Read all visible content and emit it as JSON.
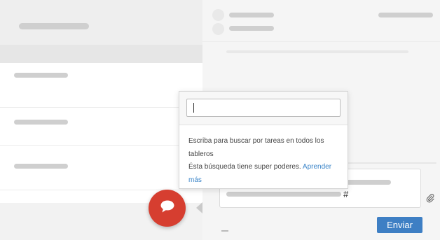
{
  "search_popover": {
    "input_value": "",
    "help_line1": "Escriba para buscar por tareas en todos los tableros",
    "help_line2": "Ésta búsqueda tiene super poderes.",
    "help_link": "Aprender más"
  },
  "composer": {
    "draft_tail": "#",
    "send_label": "Enviar"
  },
  "colors": {
    "fab": "#d63e30",
    "send_button": "#3e7fc4",
    "link": "#3a84c8"
  },
  "icons": {
    "fab": "chat-bubble-icon",
    "attach": "paperclip-icon"
  }
}
